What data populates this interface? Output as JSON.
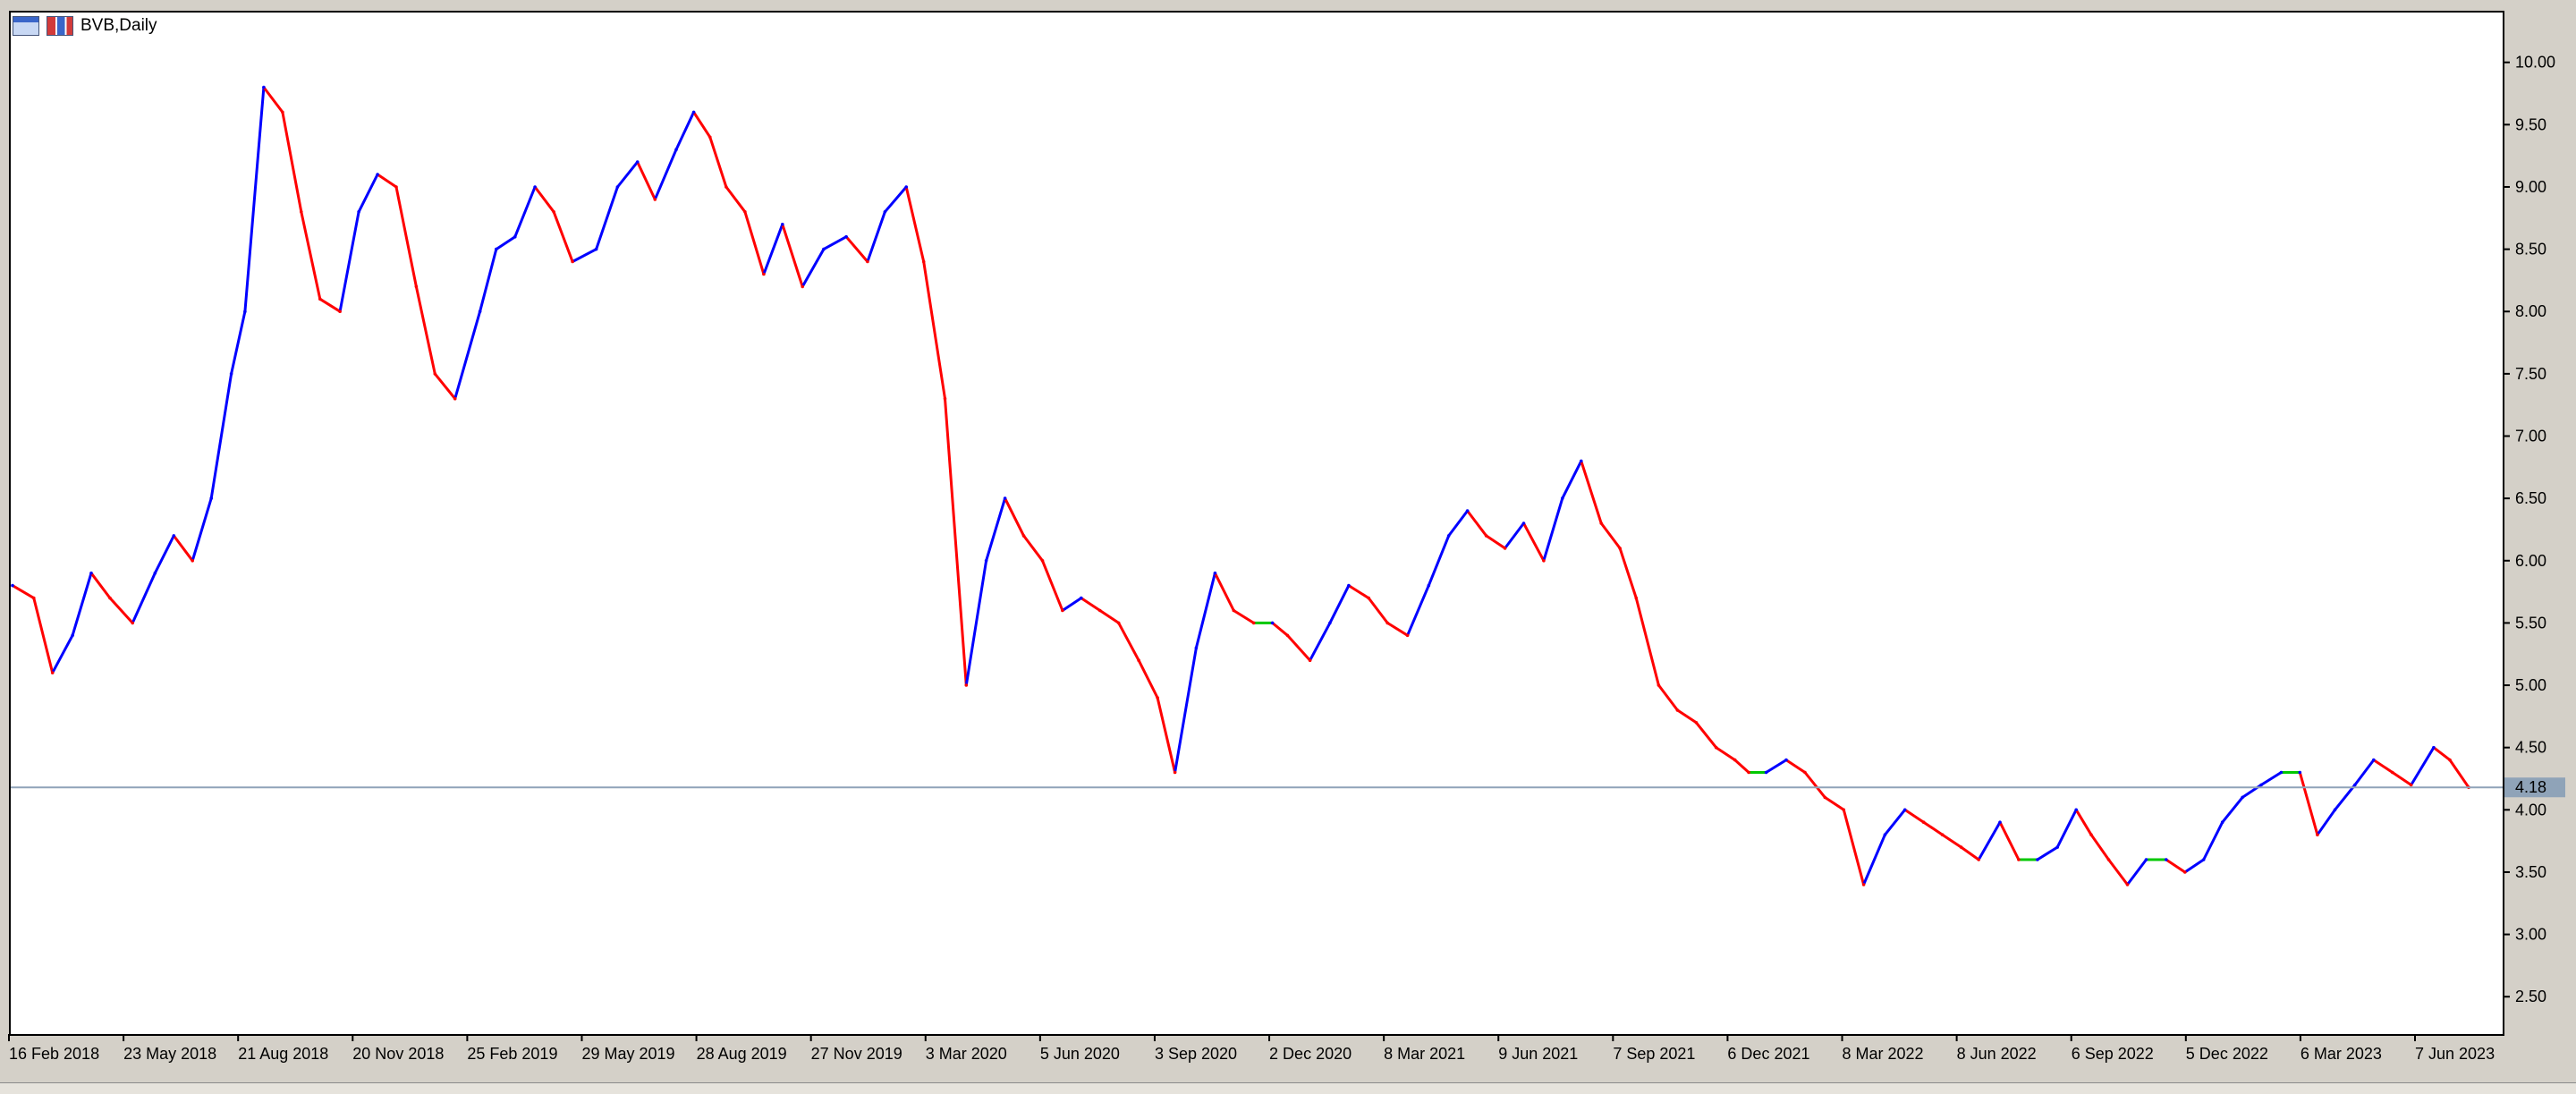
{
  "window": {
    "symbol_label": "BVB,Daily"
  },
  "chart_data": {
    "type": "line",
    "title": "BVB,Daily",
    "xlabel": "",
    "ylabel": "",
    "ylim": [
      2.2,
      10.4
    ],
    "grid": false,
    "current_price": 4.18,
    "current_price_label": "4.18",
    "y_ticks": [
      "10.00",
      "9.50",
      "9.00",
      "8.50",
      "8.00",
      "7.50",
      "7.00",
      "6.50",
      "6.00",
      "5.50",
      "5.00",
      "4.50",
      "4.00",
      "3.50",
      "3.00",
      "2.50"
    ],
    "x_tick_labels": [
      "16 Feb 2018",
      "23 May 2018",
      "21 Aug 2018",
      "20 Nov 2018",
      "25 Feb 2019",
      "29 May 2019",
      "28 Aug 2019",
      "27 Nov 2019",
      "3 Mar 2020",
      "5 Jun 2020",
      "3 Sep 2020",
      "2 Dec 2020",
      "8 Mar 2021",
      "9 Jun 2021",
      "7 Sep 2021",
      "6 Dec 2021",
      "8 Mar 2022",
      "8 Jun 2022",
      "6 Sep 2022",
      "5 Dec 2022",
      "6 Mar 2023",
      "7 Jun 2023"
    ],
    "colors": {
      "bull": "#0000ff",
      "bear": "#ff0000",
      "doji": "#00c800",
      "price_line": "#8fa3b8",
      "price_tag": "#8fa3b8"
    },
    "series": [
      {
        "x": [
          "2018-02-16",
          "2018-03-05",
          "2018-03-20",
          "2018-04-05",
          "2018-04-20",
          "2018-05-05",
          "2018-05-23",
          "2018-06-10",
          "2018-06-25",
          "2018-07-10",
          "2018-07-25",
          "2018-08-10",
          "2018-08-21",
          "2018-09-05",
          "2018-09-20",
          "2018-10-05",
          "2018-10-20",
          "2018-11-05",
          "2018-11-20",
          "2018-12-05",
          "2018-12-20",
          "2019-01-05",
          "2019-01-20",
          "2019-02-05",
          "2019-02-25",
          "2019-03-10",
          "2019-03-25",
          "2019-04-10",
          "2019-04-25",
          "2019-05-10",
          "2019-05-29",
          "2019-06-15",
          "2019-07-01",
          "2019-07-15",
          "2019-08-01",
          "2019-08-15",
          "2019-08-28",
          "2019-09-10",
          "2019-09-25",
          "2019-10-10",
          "2019-10-25",
          "2019-11-10",
          "2019-11-27",
          "2019-12-15",
          "2020-01-01",
          "2020-01-15",
          "2020-02-01",
          "2020-02-15",
          "2020-03-03",
          "2020-03-20",
          "2020-04-05",
          "2020-04-20",
          "2020-05-05",
          "2020-05-20",
          "2020-06-05",
          "2020-06-20",
          "2020-07-05",
          "2020-07-20",
          "2020-08-05",
          "2020-08-20",
          "2020-09-03",
          "2020-09-20",
          "2020-10-05",
          "2020-10-20",
          "2020-11-05",
          "2020-11-20",
          "2020-12-02",
          "2020-12-20",
          "2021-01-05",
          "2021-01-20",
          "2021-02-05",
          "2021-02-20",
          "2021-03-08",
          "2021-03-25",
          "2021-04-10",
          "2021-04-25",
          "2021-05-10",
          "2021-05-25",
          "2021-06-09",
          "2021-06-25",
          "2021-07-10",
          "2021-07-25",
          "2021-08-10",
          "2021-08-25",
          "2021-09-07",
          "2021-09-25",
          "2021-10-10",
          "2021-10-25",
          "2021-11-10",
          "2021-11-25",
          "2021-12-06",
          "2021-12-20",
          "2022-01-05",
          "2022-01-20",
          "2022-02-05",
          "2022-02-20",
          "2022-03-08",
          "2022-03-25",
          "2022-04-10",
          "2022-04-25",
          "2022-05-10",
          "2022-05-25",
          "2022-06-08",
          "2022-06-25",
          "2022-07-10",
          "2022-07-25",
          "2022-08-10",
          "2022-08-25",
          "2022-09-06",
          "2022-09-20",
          "2022-10-05",
          "2022-10-20",
          "2022-11-05",
          "2022-11-20",
          "2022-12-05",
          "2022-12-20",
          "2023-01-05",
          "2023-01-20",
          "2023-02-05",
          "2023-02-20",
          "2023-03-06",
          "2023-03-20",
          "2023-04-05",
          "2023-04-20",
          "2023-05-05",
          "2023-05-20",
          "2023-06-07",
          "2023-06-20",
          "2023-07-05"
        ],
        "y": [
          5.8,
          5.7,
          5.1,
          5.4,
          5.9,
          5.7,
          5.5,
          5.9,
          6.2,
          6.0,
          6.5,
          7.5,
          8.0,
          9.8,
          9.6,
          8.8,
          8.1,
          8.0,
          8.8,
          9.1,
          9.0,
          8.2,
          7.5,
          7.3,
          8.0,
          8.5,
          8.6,
          9.0,
          8.8,
          8.4,
          8.5,
          9.0,
          9.2,
          8.9,
          9.3,
          9.6,
          9.4,
          9.0,
          8.8,
          8.3,
          8.7,
          8.2,
          8.5,
          8.6,
          8.4,
          8.8,
          9.0,
          8.4,
          7.3,
          5.0,
          6.0,
          6.5,
          6.2,
          6.0,
          5.6,
          5.7,
          5.6,
          5.5,
          5.2,
          4.9,
          4.3,
          5.3,
          5.9,
          5.6,
          5.5,
          5.5,
          5.4,
          5.2,
          5.5,
          5.8,
          5.7,
          5.5,
          5.4,
          5.8,
          6.2,
          6.4,
          6.2,
          6.1,
          6.3,
          6.0,
          6.5,
          6.8,
          6.3,
          6.1,
          5.7,
          5.0,
          4.8,
          4.7,
          4.5,
          4.4,
          4.3,
          4.3,
          4.4,
          4.3,
          4.1,
          4.0,
          3.4,
          3.8,
          4.0,
          3.9,
          3.8,
          3.7,
          3.6,
          3.9,
          3.6,
          3.6,
          3.7,
          4.0,
          3.8,
          3.6,
          3.4,
          3.6,
          3.6,
          3.5,
          3.6,
          3.9,
          4.1,
          4.2,
          4.3,
          4.3,
          3.8,
          4.0,
          4.2,
          4.4,
          4.3,
          4.2,
          4.5,
          4.4,
          4.18
        ]
      }
    ]
  }
}
